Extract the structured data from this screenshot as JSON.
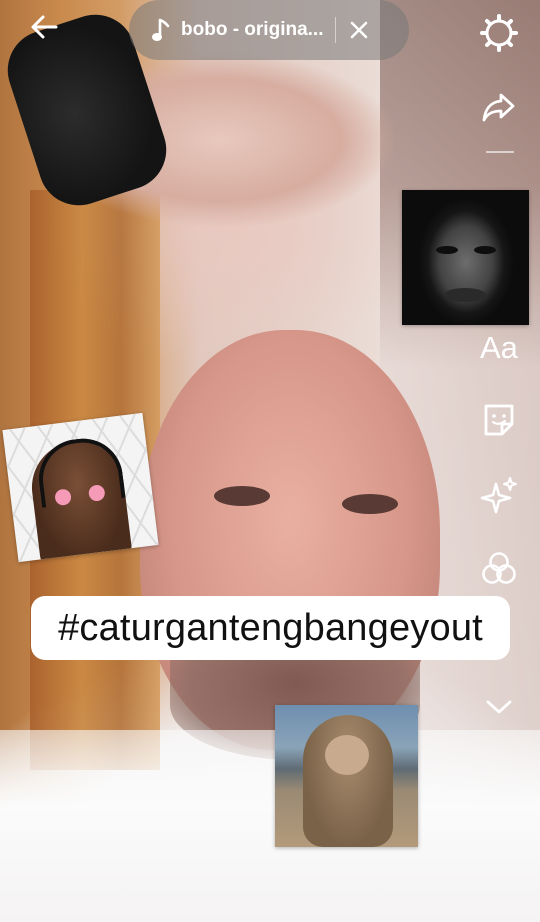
{
  "music": {
    "title": "bobo - origina..."
  },
  "rail": {
    "text_tool_label": "Aa"
  },
  "hashtag": {
    "text": "#caturgantengbangeyout"
  },
  "icons": [
    "back-arrow-icon",
    "music-note-icon",
    "close-icon",
    "settings-gear-icon",
    "share-icon",
    "text-tool",
    "sticker-icon",
    "effects-sparkle-icon",
    "filters-icon",
    "chevron-down-icon"
  ],
  "colors": {
    "pill": "#787878",
    "icon": "#ffffff",
    "hashtag_bg": "#ffffff",
    "hashtag_text": "#111111"
  }
}
